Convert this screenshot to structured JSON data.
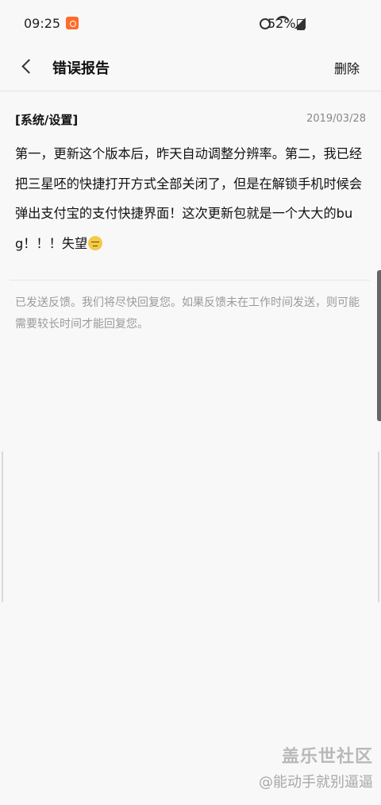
{
  "status_bar": {
    "time": "09:25",
    "battery": "52%"
  },
  "header": {
    "title": "错误报告",
    "delete_label": "删除"
  },
  "report": {
    "category": "[系统/设置]",
    "date": "2019/03/28",
    "body": "第一，更新这个版本后，昨天自动调整分辨率。第二，我已经把三星呸的快捷打开方式全部关闭了，但是在解锁手机时候会弹出支付宝的支付快捷界面！这次更新包就是一个大大的bug！！！失望"
  },
  "feedback_note": "已发送反馈。我们将尽快回复您。如果反馈未在工作时间发送，则可能需要较长时间才能回复您。",
  "watermark": {
    "title": "盖乐世社区",
    "user": "@能动手就别逼逼"
  },
  "icons": {
    "notification_app": "samsung-members-icon",
    "alarm": "alarm-icon",
    "wifi": "wifi-icon",
    "signal": "signal-icon",
    "battery": "battery-icon",
    "back": "back-arrow-icon",
    "emoji": "disappointed-face-icon"
  }
}
